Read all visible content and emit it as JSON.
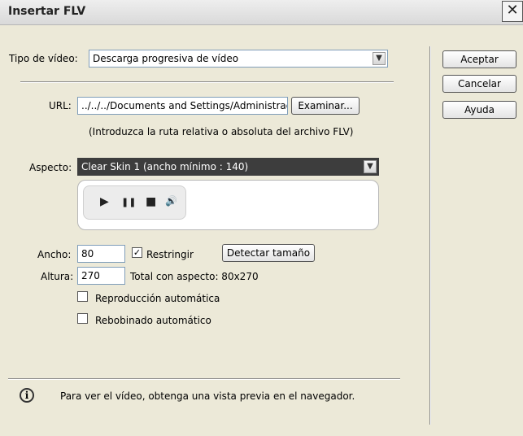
{
  "window": {
    "title": "Insertar FLV",
    "close_glyph": "✕"
  },
  "video_type": {
    "label": "Tipo de vídeo:",
    "selected": "Descarga progresiva de vídeo"
  },
  "url": {
    "label": "URL:",
    "value": "../../../Documents and Settings/Administrador/M",
    "browse_label": "Examinar...",
    "hint": "(Introduzca la ruta relativa o absoluta del archivo FLV)"
  },
  "aspect": {
    "label": "Aspecto:",
    "selected": "Clear Skin 1 (ancho mínimo : 140)"
  },
  "preview_controls": {
    "play": "▶",
    "pause": "❚❚",
    "stop": "■",
    "volume": "🔊"
  },
  "dimensions": {
    "width_label": "Ancho:",
    "width_value": "80",
    "constrain_label": "Restringir",
    "constrain_checked": true,
    "detect_label": "Detectar tamaño",
    "height_label": "Altura:",
    "height_value": "270",
    "total_label": "Total con aspecto: 80x270"
  },
  "options": {
    "autoplay_label": "Reproducción automática",
    "autoplay_checked": false,
    "autorewind_label": "Rebobinado automático",
    "autorewind_checked": false
  },
  "info": {
    "icon": "info-icon",
    "text": "Para ver el vídeo, obtenga una vista previa en el navegador."
  },
  "buttons": {
    "ok": "Aceptar",
    "cancel": "Cancelar",
    "help": "Ayuda"
  }
}
